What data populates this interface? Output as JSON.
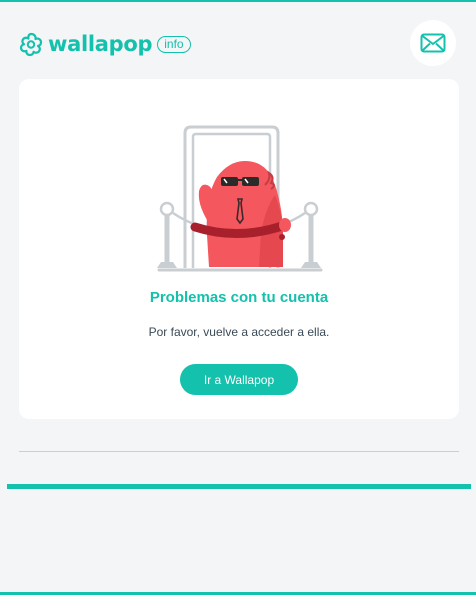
{
  "brand": {
    "name": "wallapop",
    "badge": "info",
    "color": "#13c1ac"
  },
  "header": {
    "contact_icon": "envelope-icon"
  },
  "card": {
    "illustration": "blocked-mascot-with-sunglasses-behind-rope",
    "title": "Problemas con tu cuenta",
    "message": "Por favor, vuelve a acceder a ella.",
    "button_label": "Ir a Wallapop"
  },
  "colors": {
    "accent": "#13c1ac",
    "background": "#f3f5f7",
    "card": "#ffffff",
    "text": "#3a4a57",
    "mascot": "#f4575d"
  }
}
